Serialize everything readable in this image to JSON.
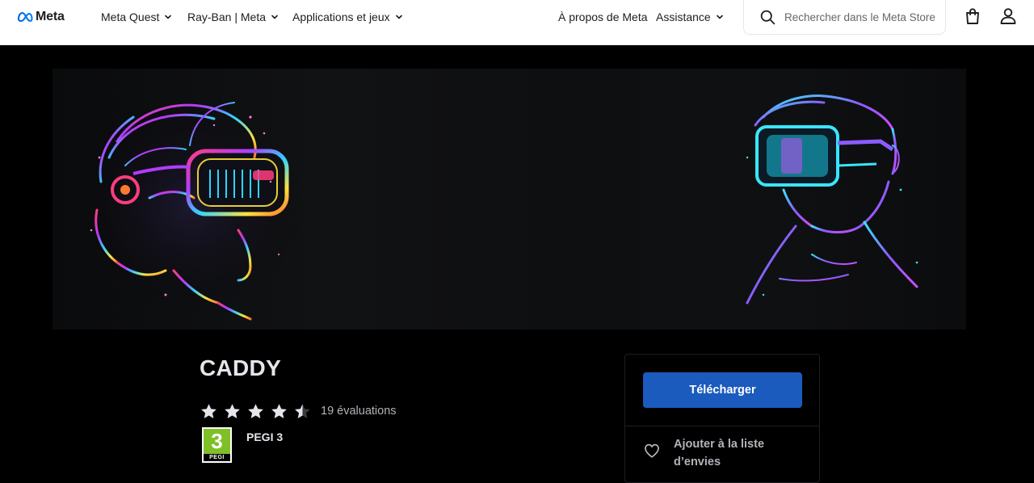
{
  "header": {
    "brand": "Meta",
    "nav_left": [
      {
        "label": "Meta Quest",
        "has_dropdown": true
      },
      {
        "label": "Ray-Ban | Meta",
        "has_dropdown": true
      },
      {
        "label": "Applications et jeux",
        "has_dropdown": true
      }
    ],
    "nav_right": [
      {
        "label": "À propos de Meta",
        "has_dropdown": false
      },
      {
        "label": "Assistance",
        "has_dropdown": true
      }
    ],
    "search": {
      "placeholder": "Rechercher dans le Meta Store"
    },
    "icons": [
      "search-icon",
      "shopping-bag-icon",
      "user-icon"
    ]
  },
  "product": {
    "title": "CADDY",
    "rating_stars": 4.5,
    "ratings_count": "19 évaluations",
    "age_rating_badge": "3",
    "age_rating_badge_word": "PEGI",
    "age_rating_label": "PEGI 3"
  },
  "actions": {
    "download_label": "Télécharger",
    "wishlist_label": "Ajouter à la liste d’envies"
  },
  "colors": {
    "accent_button": "#1b5bbd",
    "page_background": "#000000",
    "header_background": "#ffffff",
    "pegi_green": "#7fbf27"
  }
}
